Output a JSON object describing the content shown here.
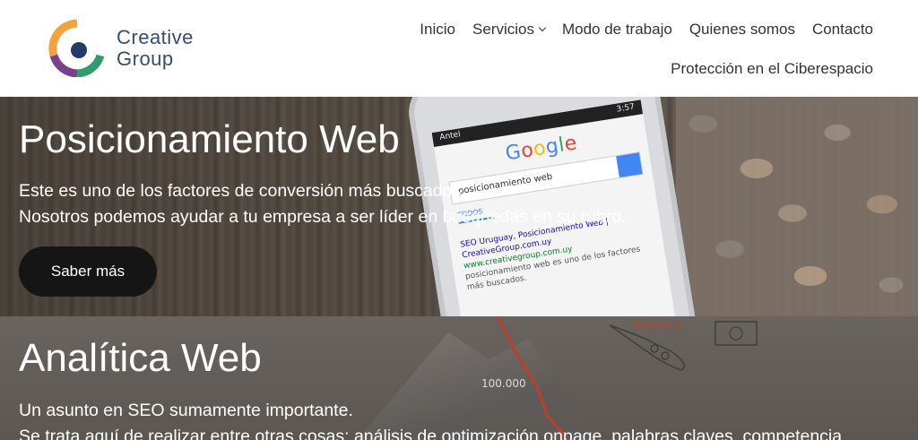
{
  "brand": {
    "name_line1": "Creative",
    "name_line2": "Group",
    "colors": {
      "orange": "#f2a33a",
      "navy": "#243a6b",
      "purple": "#7a3f8f",
      "green": "#2e9d6a",
      "text": "#3b4a6b"
    }
  },
  "nav": {
    "items": [
      {
        "label": "Inicio"
      },
      {
        "label": "Servicios",
        "icon": "chevron-down-icon"
      },
      {
        "label": "Modo de trabajo"
      },
      {
        "label": "Quienes somos"
      },
      {
        "label": "Contacto"
      },
      {
        "label": "Protección en el Ciberespacio"
      }
    ]
  },
  "hero1": {
    "title": "Posicionamiento Web",
    "line1": "Este es uno de los factores de conversión más buscados.",
    "line2": "Nosotros podemos ayudar a tu empresa a ser líder en búsquedas en su rubro.",
    "button": "Saber más",
    "phone": {
      "carrier": "Antel",
      "time": "3:57",
      "search_text": "posicionamiento web",
      "tab": "TODOS",
      "result_title": "SEO Uruguay, Posicionamiento Web | CreativeGroup.com.uy",
      "result_url": "www.creativegroup.com.uy",
      "result_snippet": "posicionamiento web es uno de los factores más buscados."
    }
  },
  "hero2": {
    "title": "Analítica Web",
    "line1": "Un asunto en SEO sumamente importante.",
    "line2": "Se trata aquí de realizar entre otras cosas: análisis de optimización onpage, palabras claves, competencia",
    "bg_label": "100.000",
    "bg_word": "Potencia"
  }
}
